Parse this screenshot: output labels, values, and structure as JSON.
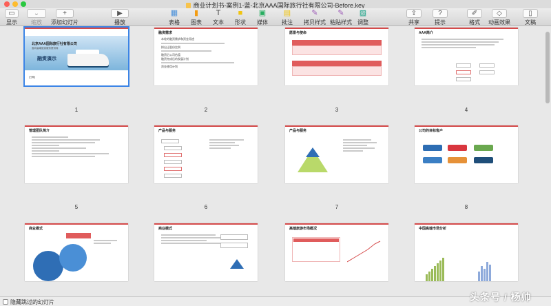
{
  "window": {
    "title": "商业计划书-案例1-蓝-北京AAA国际旅行社有限公司-Before.key"
  },
  "toolbar": {
    "left": [
      {
        "label": "显示",
        "icon": "sidebar-icon"
      },
      {
        "label": "缩放",
        "icon": "zoom-menu",
        "disabled": true
      },
      {
        "label": "添加幻灯片",
        "icon": "plus-icon"
      },
      {
        "label": "播放",
        "icon": "play-icon"
      }
    ],
    "center": [
      {
        "label": "表格",
        "icon": "table-icon"
      },
      {
        "label": "图表",
        "icon": "chart-icon"
      },
      {
        "label": "文本",
        "icon": "text-icon"
      },
      {
        "label": "形状",
        "icon": "shape-icon"
      },
      {
        "label": "媒体",
        "icon": "media-icon"
      },
      {
        "label": "批注",
        "icon": "comment-icon"
      },
      {
        "label": "拷贝样式",
        "icon": "copy-style-icon"
      },
      {
        "label": "粘贴样式",
        "icon": "paste-style-icon"
      },
      {
        "label": "调整",
        "icon": "adjust-icon"
      }
    ],
    "right": [
      {
        "label": "共享",
        "icon": "share-icon"
      },
      {
        "label": "提示",
        "icon": "tips-icon"
      },
      {
        "label": "格式",
        "icon": "format-icon"
      },
      {
        "label": "动画效果",
        "icon": "animate-icon"
      },
      {
        "label": "文稿",
        "icon": "document-icon"
      }
    ]
  },
  "slides": [
    {
      "number": "1",
      "title": "北京AAA国际旅行社有限公司",
      "subtitle": "面向高端旅游服务提供商",
      "heading": "融资演示",
      "footer": "[日期]"
    },
    {
      "number": "2",
      "title": "融资需求",
      "bullets": [
        "本轮的融资需求和资金用途",
        "拟出让股份比例",
        "融资后公司估值",
        "融资完成后的发展计划",
        "资金使用计划"
      ]
    },
    {
      "number": "3",
      "title": "愿景与使命",
      "vision": "愿景",
      "mission": "使命"
    },
    {
      "number": "4",
      "title": "AAA简介"
    },
    {
      "number": "5",
      "title": "管理团队简介"
    },
    {
      "number": "6",
      "title": "产品与服务"
    },
    {
      "number": "7",
      "title": "产品与服务"
    },
    {
      "number": "8",
      "title": "公司的目标客户"
    },
    {
      "number": "",
      "title": "商业模式"
    },
    {
      "number": "",
      "title": "商业模式"
    },
    {
      "number": "",
      "title": "高端旅游市场概况"
    },
    {
      "number": "",
      "title": "中国高端市场分析"
    }
  ],
  "bottom": {
    "skip_label": "隐藏跳过的幻灯片"
  },
  "watermark": "头条号 / 杨帅",
  "colors": {
    "accent": "#d54a4a",
    "selection": "#3b84e6"
  }
}
